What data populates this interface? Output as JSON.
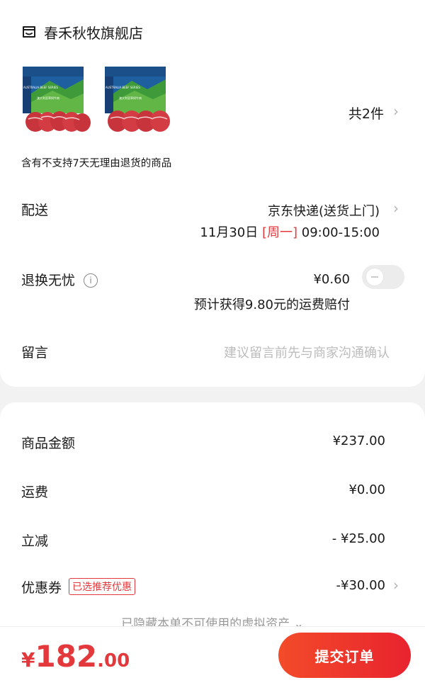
{
  "store": {
    "name": "春禾秋牧旗舰店",
    "icon": "store-icon"
  },
  "products": {
    "thumbnails": [
      {
        "brand_text": "AUSTRALIA BEEF SERIES",
        "sub_text": "澳大利亚草饲牛肉"
      },
      {
        "brand_text": "AUSTRALIA BEEF SERIES",
        "sub_text": "澳大利亚草饲牛肉"
      }
    ],
    "count_label": "共2件"
  },
  "notice": "含有不支持7天无理由退货的商品",
  "delivery": {
    "label": "配送",
    "method": "京东快递(送货上门)",
    "date": "11月30日",
    "weekday": "[周一]",
    "time": "09:00-15:00"
  },
  "return_worry_free": {
    "label": "退换无忧",
    "price": "¥0.60",
    "desc": "预计获得9.80元的运费赔付",
    "enabled": false
  },
  "message": {
    "label": "留言",
    "placeholder": "建议留言前先与商家沟通确认"
  },
  "summary": {
    "goods_label": "商品金额",
    "goods_value": "¥237.00",
    "shipping_label": "运费",
    "shipping_value": "¥0.00",
    "discount_label": "立减",
    "discount_value": "- ¥25.00",
    "coupon_label": "优惠券",
    "coupon_badge": "已选推荐优惠",
    "coupon_value": "-¥30.00",
    "hidden_note": "已隐藏本单不可使用的虚拟资产"
  },
  "footer": {
    "currency": "¥",
    "total_int": "182",
    "total_dec": ".00",
    "submit_label": "提交订单"
  },
  "colors": {
    "accent": "#e4393c",
    "button_start": "#f34b2a",
    "button_end": "#e8232e"
  }
}
